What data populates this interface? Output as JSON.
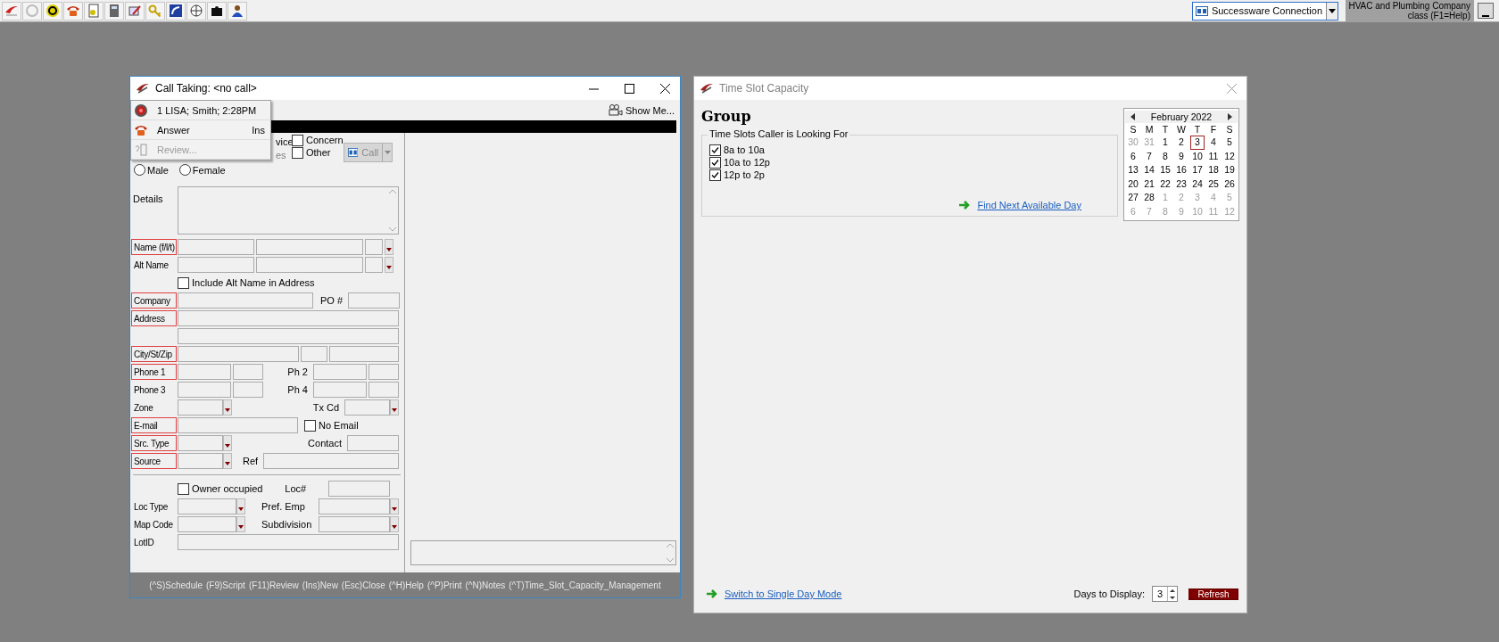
{
  "top_bar": {
    "connection": "Successware Connection",
    "company_lines": [
      "HVAC and Plumbing Company",
      "class (F1=Help)"
    ]
  },
  "call_window": {
    "title": "Call Taking: <no call>",
    "show_me": "Show Me...",
    "menu": [
      {
        "kind": "call",
        "label": "1 LISA; Smith; 2:28PM",
        "disabled": false
      },
      {
        "kind": "answer",
        "label": "Answer",
        "shortcut": "Ins",
        "disabled": false
      },
      {
        "kind": "review",
        "label": "Review...",
        "disabled": true
      }
    ],
    "covered_labels": [
      {
        "text": "vice",
        "disabled": false
      },
      {
        "text": "es",
        "disabled": true
      }
    ],
    "call_types": [
      {
        "label": "Concern",
        "checked": false
      },
      {
        "label": "Other",
        "checked": false
      }
    ],
    "call_button": {
      "label": "Call",
      "disabled": true
    },
    "gender": [
      {
        "label": "Male",
        "selected": false
      },
      {
        "label": "Female",
        "selected": false
      }
    ],
    "details_label": "Details",
    "rows": [
      {
        "kind": "name",
        "label": "Name (f/l/t)",
        "required": true
      },
      {
        "kind": "name",
        "label": "Alt Name",
        "required": false
      },
      {
        "kind": "checkbox",
        "check_label": "Include Alt Name in Address",
        "checked": false
      },
      {
        "kind": "company",
        "label": "Company",
        "required": true,
        "label2": "PO #"
      },
      {
        "kind": "wide",
        "label": "Address",
        "required": true
      },
      {
        "kind": "blank"
      },
      {
        "kind": "city",
        "label": "City/St/Zip",
        "required": true
      },
      {
        "kind": "phone",
        "label": "Phone 1",
        "required": true,
        "label2": "Ph 2"
      },
      {
        "kind": "phone",
        "label": "Phone 3",
        "required": false,
        "label2": "Ph 4"
      },
      {
        "kind": "zone",
        "label": "Zone",
        "required": false,
        "label2": "Tx Cd"
      },
      {
        "kind": "email",
        "label": "E-mail",
        "required": true,
        "check_label": "No Email",
        "checked": false
      },
      {
        "kind": "srctype",
        "label": "Src. Type",
        "required": true,
        "label2": "Contact"
      },
      {
        "kind": "source",
        "label": "Source",
        "required": true,
        "label2": "Ref"
      },
      {
        "kind": "divider"
      },
      {
        "kind": "owner",
        "check_label": "Owner occupied",
        "checked": false,
        "label2": "Loc#"
      },
      {
        "kind": "combo2",
        "label": "Loc Type",
        "required": false,
        "label2": "Pref. Emp"
      },
      {
        "kind": "combo2",
        "label": "Map Code",
        "required": false,
        "label2": "Subdivision"
      },
      {
        "kind": "wide",
        "label": "LotID",
        "required": false
      }
    ],
    "status_bar": [
      "(^S)Schedule",
      "(F9)Script",
      "(F11)Review",
      "(Ins)New",
      "(Esc)Close",
      "(^H)Help",
      "(^P)Print",
      "(^N)Notes",
      "(^T)Time_Slot_Capacity_Management"
    ]
  },
  "slot_window": {
    "title": "Time Slot Capacity",
    "heading": "Group",
    "group_title": "Time Slots Caller is Looking For",
    "slots": [
      {
        "label": "8a to 10a",
        "checked": true
      },
      {
        "label": "10a to 12p",
        "checked": true
      },
      {
        "label": "12p to 2p",
        "checked": true
      }
    ],
    "find_link": "Find Next Available Day",
    "calendar": {
      "month": "February 2022",
      "weekdays": [
        "S",
        "M",
        "T",
        "W",
        "T",
        "F",
        "S"
      ],
      "weeks": [
        [
          {
            "day": "30",
            "muted": true,
            "selected": false
          },
          {
            "day": "31",
            "muted": true,
            "selected": false
          },
          {
            "day": "1",
            "muted": false,
            "selected": false
          },
          {
            "day": "2",
            "muted": false,
            "selected": false
          },
          {
            "day": "3",
            "muted": false,
            "selected": true
          },
          {
            "day": "4",
            "muted": false,
            "selected": false
          },
          {
            "day": "5",
            "muted": false,
            "selected": false
          }
        ],
        [
          {
            "day": "6",
            "muted": false,
            "selected": false
          },
          {
            "day": "7",
            "muted": false,
            "selected": false
          },
          {
            "day": "8",
            "muted": false,
            "selected": false
          },
          {
            "day": "9",
            "muted": false,
            "selected": false
          },
          {
            "day": "10",
            "muted": false,
            "selected": false
          },
          {
            "day": "11",
            "muted": false,
            "selected": false
          },
          {
            "day": "12",
            "muted": false,
            "selected": false
          }
        ],
        [
          {
            "day": "13",
            "muted": false,
            "selected": false
          },
          {
            "day": "14",
            "muted": false,
            "selected": false
          },
          {
            "day": "15",
            "muted": false,
            "selected": false
          },
          {
            "day": "16",
            "muted": false,
            "selected": false
          },
          {
            "day": "17",
            "muted": false,
            "selected": false
          },
          {
            "day": "18",
            "muted": false,
            "selected": false
          },
          {
            "day": "19",
            "muted": false,
            "selected": false
          }
        ],
        [
          {
            "day": "20",
            "muted": false,
            "selected": false
          },
          {
            "day": "21",
            "muted": false,
            "selected": false
          },
          {
            "day": "22",
            "muted": false,
            "selected": false
          },
          {
            "day": "23",
            "muted": false,
            "selected": false
          },
          {
            "day": "24",
            "muted": false,
            "selected": false
          },
          {
            "day": "25",
            "muted": false,
            "selected": false
          },
          {
            "day": "26",
            "muted": false,
            "selected": false
          }
        ],
        [
          {
            "day": "27",
            "muted": false,
            "selected": false
          },
          {
            "day": "28",
            "muted": false,
            "selected": false
          },
          {
            "day": "1",
            "muted": true,
            "selected": false
          },
          {
            "day": "2",
            "muted": true,
            "selected": false
          },
          {
            "day": "3",
            "muted": true,
            "selected": false
          },
          {
            "day": "4",
            "muted": true,
            "selected": false
          },
          {
            "day": "5",
            "muted": true,
            "selected": false
          }
        ],
        [
          {
            "day": "6",
            "muted": true,
            "selected": false
          },
          {
            "day": "7",
            "muted": true,
            "selected": false
          },
          {
            "day": "8",
            "muted": true,
            "selected": false
          },
          {
            "day": "9",
            "muted": true,
            "selected": false
          },
          {
            "day": "10",
            "muted": true,
            "selected": false
          },
          {
            "day": "11",
            "muted": true,
            "selected": false
          },
          {
            "day": "12",
            "muted": true,
            "selected": false
          }
        ]
      ]
    },
    "switch_link": "Switch to Single Day Mode",
    "days_label": "Days to Display:",
    "days_value": "3",
    "refresh": "Refresh"
  }
}
